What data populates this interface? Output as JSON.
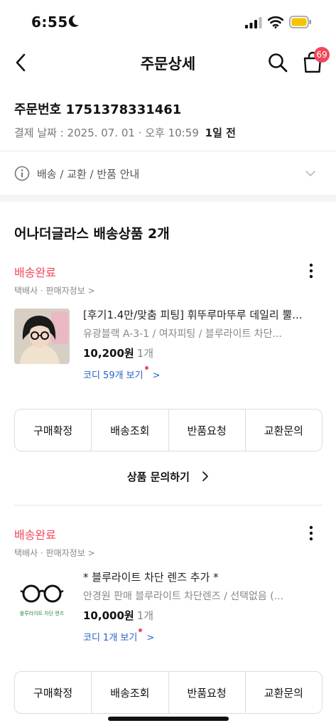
{
  "status_bar": {
    "time": "6:55"
  },
  "header": {
    "title": "주문상세",
    "cart_count": "69"
  },
  "order": {
    "number_label": "주문번호 1751378331461",
    "date_label": "결제 날짜 : 2025. 07. 01 · 오후 10:59",
    "ago": "1일 전"
  },
  "notice": {
    "label": "배송 / 교환 / 반품 안내"
  },
  "section": {
    "title": "어나더글라스 배송상품 2개"
  },
  "items": [
    {
      "status": "배송완료",
      "seller": "택배사 · 판매자정보 >",
      "name": "[후기1.4만/맞춤 피팅] 휘뚜루마뚜루 데일리 뿔...",
      "option": "유광블랙 A-3-1 / 여자피팅 / 블루라이트 차단...",
      "price": "10,200원",
      "qty": "1개",
      "coordi": "코디 59개 보기",
      "coordi_arrow": ">",
      "buttons": [
        "구매확정",
        "배송조회",
        "반품요청",
        "교환문의"
      ],
      "inquiry": "상품 문의하기"
    },
    {
      "status": "배송완료",
      "seller": "택배사 · 판매자정보 >",
      "name": "* 블루라이트 차단 렌즈 추가 *",
      "option": "안경원 판매 블루라이트 차단렌즈 / 선택없음 (...",
      "price": "10,000원",
      "qty": "1개",
      "coordi": "코디 1개 보기",
      "coordi_arrow": ">",
      "thumb_caption": "블루라이트 차단 렌즈",
      "buttons": [
        "구매확정",
        "배송조회",
        "반품요청",
        "교환문의"
      ]
    }
  ],
  "colors": {
    "accent_red": "#f2475a",
    "link_blue": "#2563c9",
    "battery_yellow": "#f5c400"
  }
}
